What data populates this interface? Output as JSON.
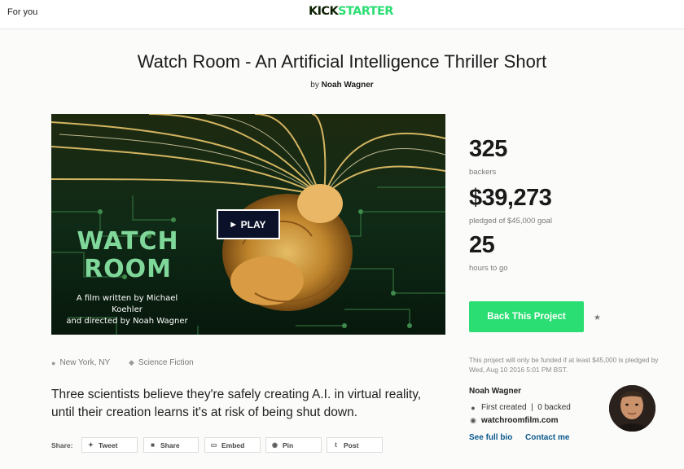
{
  "header": {
    "for_you": "For you",
    "logo_part1": "KICK",
    "logo_part2": "STARTER"
  },
  "project": {
    "title": "Watch Room - An Artificial Intelligence Thriller Short",
    "by_prefix": "by",
    "creator": "Noah Wagner"
  },
  "video": {
    "poster_title_line1": "WATCH",
    "poster_title_line2": "ROOM",
    "poster_credit_line1": "A film written by Michael Koehler",
    "poster_credit_line2": "and directed by Noah Wagner",
    "play_label": "PLAY",
    "play_icon": "play-icon"
  },
  "stats": {
    "backers_value": "325",
    "backers_label": "backers",
    "pledged_value": "$39,273",
    "pledged_label": "pledged of $45,000 goal",
    "hours_value": "25",
    "hours_label": "hours to go"
  },
  "cta": {
    "back_label": "Back This Project",
    "remind_icon": "star-icon",
    "funding_note": "This project will only be funded if at least $45,000 is pledged by Wed, Aug 10 2016 5:01 PM BST."
  },
  "creator_card": {
    "name": "Noah Wagner",
    "created_text": "First created  |  0 backed",
    "website": "watchroomfilm.com",
    "see_bio": "See full bio",
    "contact": "Contact me"
  },
  "meta": {
    "location": "New York, NY",
    "category": "Science Fiction"
  },
  "blurb": "Three scientists believe they're safely creating A.I. in virtual reality, until their creation learns it's at risk of being shut down.",
  "share": {
    "label": "Share:",
    "buttons": [
      "Tweet",
      "Share",
      "Embed",
      "Pin",
      "Post"
    ]
  },
  "colors": {
    "accent_green": "#2bde73",
    "logo_dark": "#0f2105",
    "link_blue": "#0b5a8c",
    "play_bg": "#0a1128"
  }
}
